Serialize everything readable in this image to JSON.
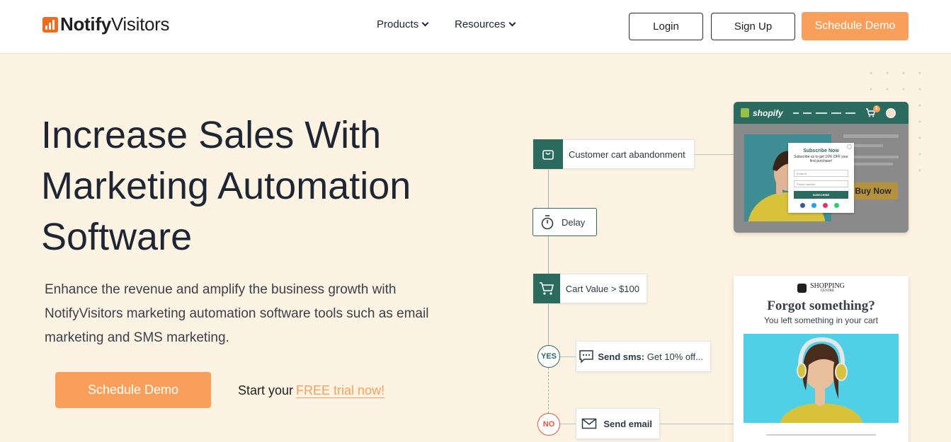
{
  "header": {
    "logo_bold": "Notify",
    "logo_light": "Visitors",
    "nav": [
      {
        "label": "Products"
      },
      {
        "label": "Resources"
      }
    ],
    "login_label": "Login",
    "signup_label": "Sign Up",
    "demo_label": "Schedule Demo"
  },
  "hero": {
    "title_lines": [
      "Increase Sales With",
      "Marketing Automation",
      "Software"
    ],
    "description": "Enhance the revenue and amplify the business growth with NotifyVisitors marketing automation software tools such as email marketing and SMS marketing.",
    "cta_label": "Schedule Demo",
    "trial_prefix": "Start your",
    "trial_link": "FREE trial now!"
  },
  "flow": {
    "cart_abandon": "Customer cart abandonment",
    "delay": "Delay",
    "cart_value": "Cart Value > $100",
    "yes": "YES",
    "no": "NO",
    "sms_bold": "Send sms:",
    "sms_text": "Get 10% off...",
    "email": "Send email"
  },
  "shopify_mock": {
    "brand": "shopify",
    "cart_count": "1",
    "popup_title": "Subscribe Now",
    "popup_text": "Subscribe us to get 10% OFF your first purchase!",
    "popup_email": "Email id",
    "popup_phone": "Phone number",
    "popup_button": "SUBSCRIBE",
    "buy_now": "Buy Now"
  },
  "email_mock": {
    "brand_line1": "SHOPPING",
    "brand_line2": "CENTRE",
    "heading": "Forgot something?",
    "subheading": "You left something in your cart"
  },
  "colors": {
    "accent_orange": "#f8a05b",
    "teal": "#2a6a5f",
    "hero_bg": "#fdf3e2",
    "no_red": "#e5533d"
  }
}
